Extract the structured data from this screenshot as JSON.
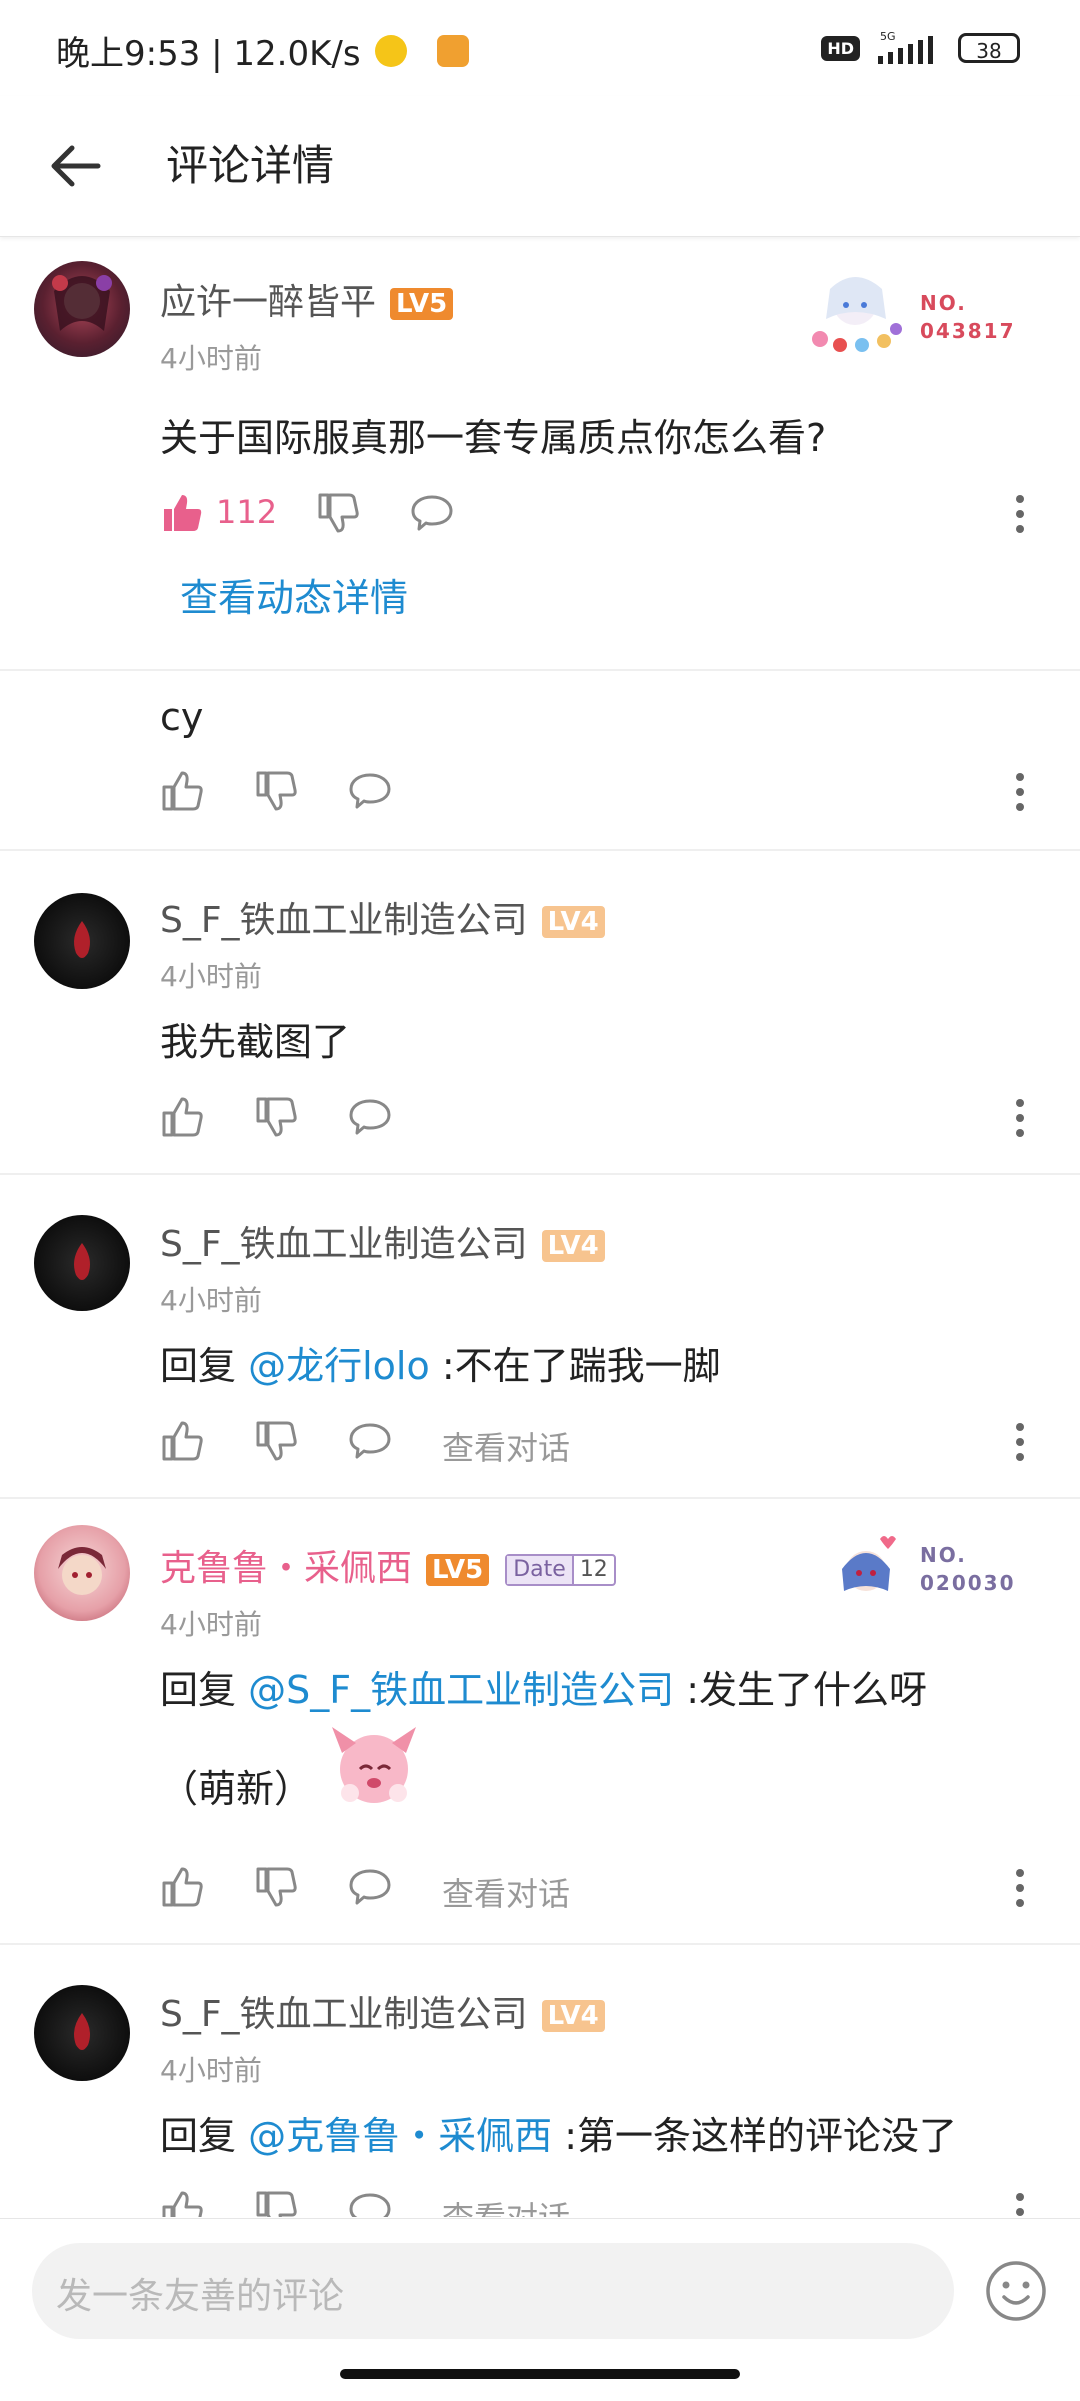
{
  "status_bar": {
    "time": "晚上9:53 | 12.0K/s",
    "hd": "HD",
    "network": "5G",
    "battery": "38"
  },
  "header": {
    "title": "评论详情"
  },
  "main_comment": {
    "user": "应许一醉皆平",
    "level": "LV5",
    "time": "4小时前",
    "text": "关于国际服真那一套专属质点你怎么看?",
    "likes": "112",
    "detail_link": "查看动态详情",
    "badge_no": "NO.",
    "badge_num": "043817"
  },
  "replies": [
    {
      "user": "",
      "level": "",
      "time": "",
      "text": "cy"
    },
    {
      "user": "S_F_铁血工业制造公司",
      "level": "LV4",
      "time": "4小时前",
      "text": "我先截图了"
    },
    {
      "user": "S_F_铁血工业制造公司",
      "level": "LV4",
      "time": "4小时前",
      "reply_prefix": "回复",
      "mention": "@龙行lolo",
      "text": ":不在了踹我一脚",
      "view": "查看对话"
    },
    {
      "user": "克鲁鲁・采佩西",
      "level": "LV5",
      "date_tag": "Date",
      "date_num": "12",
      "badge_no": "NO.",
      "badge_num": "020030",
      "time": "4小时前",
      "reply_prefix": "回复",
      "mention": "@S_F_铁血工业制造公司",
      "text": ":发生了什么呀",
      "text2": "（萌新）",
      "view": "查看对话"
    },
    {
      "user": "S_F_铁血工业制造公司",
      "level": "LV4",
      "time": "4小时前",
      "reply_prefix": "回复",
      "mention": "@克鲁鲁・采佩西",
      "text": ":第一条这样的评论没了",
      "view": "查看对话"
    }
  ],
  "input": {
    "placeholder": "发一条友善的评论"
  },
  "colors": {
    "accent_pink": "#e8608c",
    "link_blue": "#1e8bd0",
    "lv5": "#ef8a2e",
    "lv4": "#f7c48f"
  }
}
